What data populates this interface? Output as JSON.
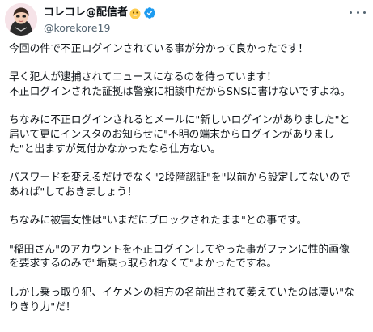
{
  "user": {
    "display_name": "コレコレ@配信者",
    "handle": "@korekore19",
    "name_emoji": "grinning-face-emoji",
    "verified_badge": "verified-badge-icon",
    "colors": {
      "verified": "#1d9bf0",
      "handle": "#536471",
      "text": "#0f1419"
    }
  },
  "menu": {
    "icon": "more-options-icon"
  },
  "tweet": {
    "line_01": "今回の件で不正ログインされている事が分かって良かったです！",
    "line_02": "早く犯人が逮捕されてニュースになるのを待っています！",
    "line_03": "不正ログインされた証拠は警察に相談中だからSNSに書けないですよね。",
    "line_04": "ちなみに不正ログインされるとメールに\"新しいログインがありました\"と",
    "line_05": "届いて更にインスタのお知らせに\"不明の端末からログインがありまし",
    "line_06": "た\"と出ますが気付かなかったなら仕方ない。",
    "line_07": "パスワードを変えるだけでなく\"2段階認証\"を\"以前から設定してないので",
    "line_08": "あれば\"しておきましょう！",
    "line_09": "ちなみに被害女性は\"いまだにブロックされたまま\"との事です。",
    "line_10": "\"稲田さん\"のアカウントを不正ログインしてやった事がファンに性的画像",
    "line_11": "を要求するのみで\"垢乗っ取られなくて\"よかったですね。",
    "line_12": "しかし乗っ取り犯、イケメンの相方の名前出されて萎えていたのは凄い\"な",
    "line_13": "りきり力\"だ！"
  }
}
